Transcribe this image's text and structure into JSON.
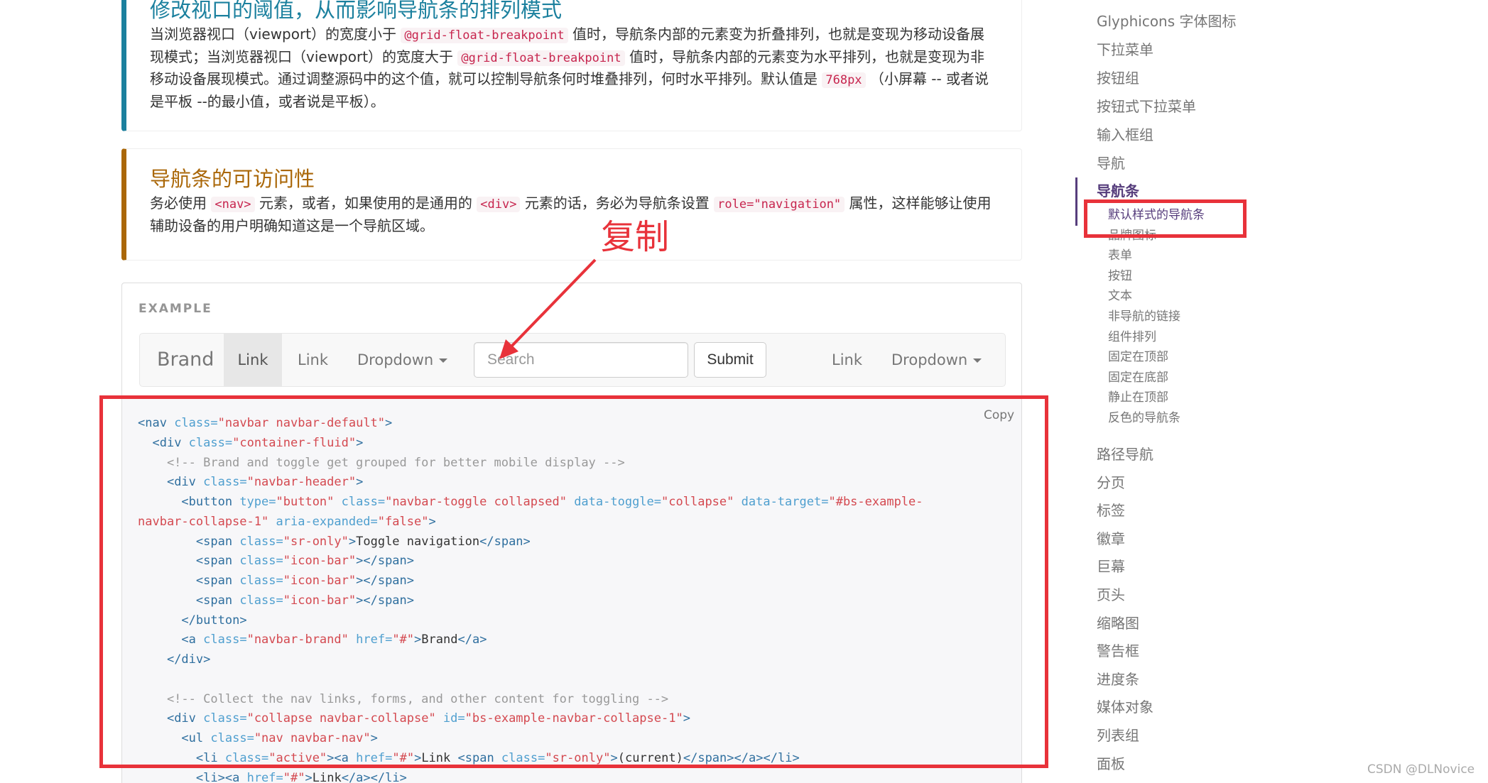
{
  "callout_breakpoint": {
    "title": "修改视口的阈值，从而影响导航条的排列模式",
    "text_parts": [
      "当浏览器视口（viewport）的宽度小于",
      "@grid-float-breakpoint",
      "值时，导航条内部的元素变为折叠排列，也就是变现为移动设备展现模式；当浏览器视口（viewport）的宽度大于",
      "@grid-float-breakpoint",
      "值时，导航条内部的元素变为水平排列，也就是变现为非移动设备展现模式。通过调整源码中的这个值，就可以控制导航条何时堆叠排列，何时水平排列。默认值是",
      "768px",
      "（小屏幕 -- 或者说是平板 --的最小值，或者说是平板）。"
    ]
  },
  "callout_accessibility": {
    "title": "导航条的可访问性",
    "text_parts": [
      "务必使用",
      "<nav>",
      "元素，或者，如果使用的是通用的",
      "<div>",
      "元素的话，务必为导航条设置",
      "role=\"navigation\"",
      "属性，这样能够让使用辅助设备的用户明确知道这是一个导航区域。"
    ]
  },
  "example": {
    "label": "EXAMPLE",
    "copy_label": "Copy",
    "navbar": {
      "brand": "Brand",
      "active_link": "Link",
      "link": "Link",
      "dropdown": "Dropdown",
      "search_placeholder": "Search",
      "submit": "Submit",
      "right_link": "Link",
      "right_dropdown": "Dropdown"
    },
    "code_lines": [
      "<nav class=\"navbar navbar-default\">",
      "  <div class=\"container-fluid\">",
      "    <!-- Brand and toggle get grouped for better mobile display -->",
      "    <div class=\"navbar-header\">",
      "      <button type=\"button\" class=\"navbar-toggle collapsed\" data-toggle=\"collapse\" data-target=\"#bs-example-",
      "navbar-collapse-1\" aria-expanded=\"false\">",
      "        <span class=\"sr-only\">Toggle navigation</span>",
      "        <span class=\"icon-bar\"></span>",
      "        <span class=\"icon-bar\"></span>",
      "        <span class=\"icon-bar\"></span>",
      "      </button>",
      "      <a class=\"navbar-brand\" href=\"#\">Brand</a>",
      "    </div>",
      "",
      "    <!-- Collect the nav links, forms, and other content for toggling -->",
      "    <div class=\"collapse navbar-collapse\" id=\"bs-example-navbar-collapse-1\">",
      "      <ul class=\"nav navbar-nav\">",
      "        <li class=\"active\"><a href=\"#\">Link <span class=\"sr-only\">(current)</span></a></li>",
      "        <li><a href=\"#\">Link</a></li>"
    ]
  },
  "sidebar": {
    "items_top": [
      "Glyphicons 字体图标",
      "下拉菜单",
      "按钮组",
      "按钮式下拉菜单",
      "输入框组",
      "导航"
    ],
    "active_item": "导航条",
    "sub_items": [
      "默认样式的导航条",
      "品牌图标",
      "表单",
      "按钮",
      "文本",
      "非导航的链接",
      "组件排列",
      "固定在顶部",
      "固定在底部",
      "静止在顶部",
      "反色的导航条"
    ],
    "items_bottom": [
      "路径导航",
      "分页",
      "标签",
      "徽章",
      "巨幕",
      "页头",
      "缩略图",
      "警告框",
      "进度条",
      "媒体对象",
      "列表组",
      "面板"
    ]
  },
  "annotation": {
    "text": "复制",
    "color": "#e8323a"
  },
  "watermark": "CSDN @DLNovice",
  "colors": {
    "info_accent": "#1b809e",
    "warning_accent": "#aa6708",
    "sidebar_active": "#563d7c",
    "code_inline": "#c7254e"
  }
}
